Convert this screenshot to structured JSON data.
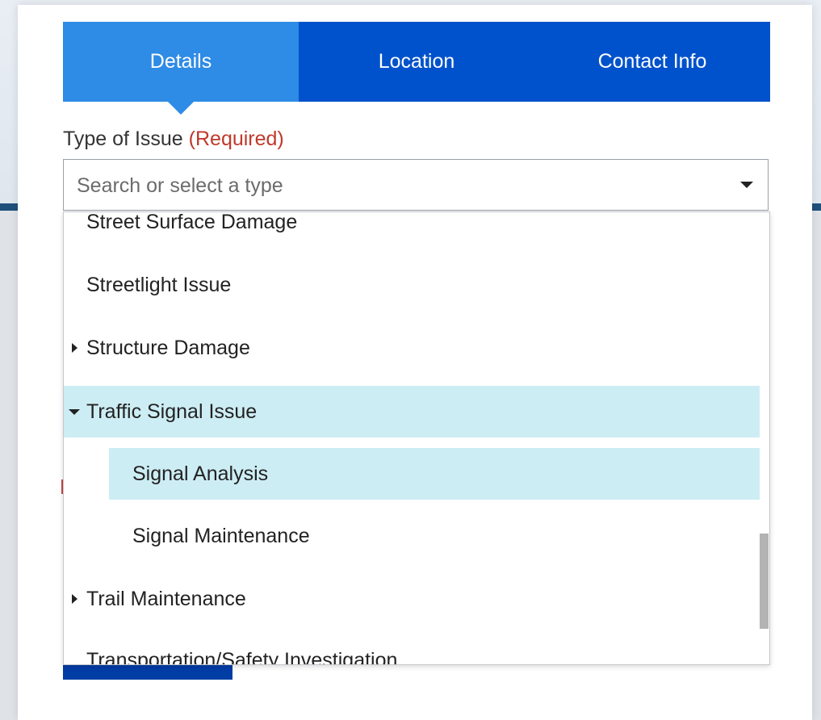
{
  "tabs": [
    {
      "label": "Details",
      "active": true
    },
    {
      "label": "Location",
      "active": false
    },
    {
      "label": "Contact Info",
      "active": false
    }
  ],
  "field": {
    "label": "Type of Issue",
    "required": "(Required)",
    "placeholder": "Search or select a type"
  },
  "options": [
    {
      "label": "Street Surface Damage",
      "expander": "none",
      "level": 0
    },
    {
      "label": "Streetlight Issue",
      "expander": "none",
      "level": 0
    },
    {
      "label": "Structure Damage",
      "expander": "collapsed",
      "level": 0
    },
    {
      "label": "Traffic Signal Issue",
      "expander": "expanded",
      "level": 0,
      "highlighted": true
    },
    {
      "label": "Signal Analysis",
      "expander": "none",
      "level": 1,
      "highlighted": true
    },
    {
      "label": "Signal Maintenance",
      "expander": "none",
      "level": 1
    },
    {
      "label": "Trail Maintenance",
      "expander": "collapsed",
      "level": 0
    },
    {
      "label": "Transportation/Safety Investigation",
      "expander": "none",
      "level": 0
    }
  ],
  "colors": {
    "tab_bar": "#0052cc",
    "tab_active": "#2e8be6",
    "required": "#c0392b",
    "highlight": "#cdedf4"
  }
}
